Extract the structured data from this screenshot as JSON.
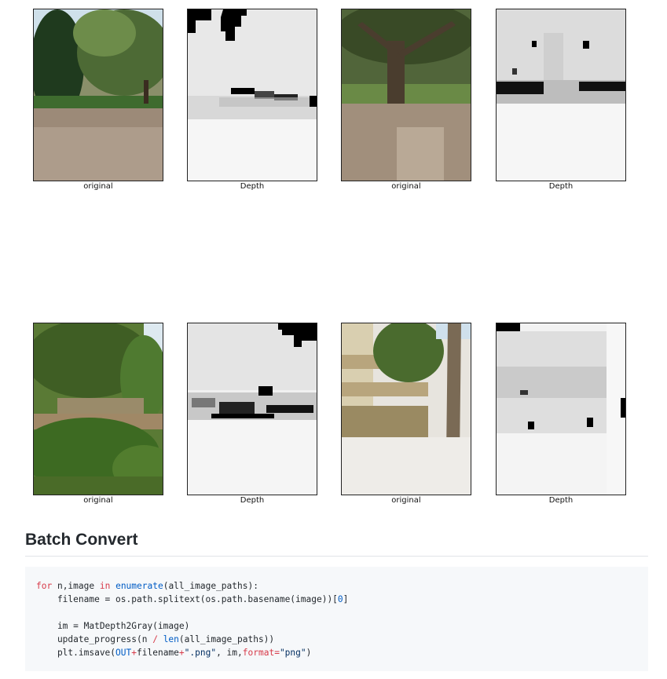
{
  "figures": [
    {
      "caption": "original",
      "kind": "photo-trees-leaves"
    },
    {
      "caption": "Depth",
      "kind": "depth-map"
    },
    {
      "caption": "original",
      "kind": "photo-oak-tree"
    },
    {
      "caption": "Depth",
      "kind": "depth-map"
    },
    {
      "caption": "original",
      "kind": "photo-garden"
    },
    {
      "caption": "Depth",
      "kind": "depth-map"
    },
    {
      "caption": "original",
      "kind": "photo-building-palm"
    },
    {
      "caption": "Depth",
      "kind": "depth-map"
    }
  ],
  "section": {
    "title": "Batch Convert"
  },
  "code": {
    "line1": {
      "kw1": "for",
      "vars": " n,image ",
      "kw2": "in",
      "fn": "enumerate",
      "rest": "(all_image_paths):"
    },
    "line2": {
      "text": "    filename = os.path.splitext(os.path.basename(image))[",
      "num": "0",
      "end": "]"
    },
    "line3": {
      "text": "    im = MatDepth2Gray(image)"
    },
    "line4": {
      "a": "    update_progress(n ",
      "op": "/",
      "b": " ",
      "fn": "len",
      "c": "(all_image_paths))"
    },
    "line5": {
      "a": "    plt.imsave(",
      "out": "OUT",
      "op1": "+",
      "b": "filename",
      "op2": "+",
      "str1": "\".png\"",
      "c": ", im,",
      "kw": "format",
      "op3": "=",
      "str2": "\"png\"",
      "d": ")"
    }
  }
}
